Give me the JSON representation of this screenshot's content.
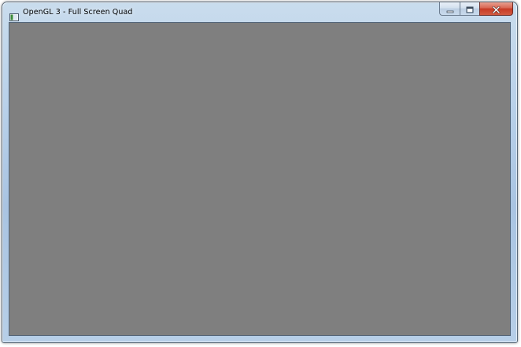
{
  "window": {
    "title": "OpenGL 3 - Full Screen Quad",
    "app_icon": "application-window-icon",
    "caption_buttons": {
      "minimize_icon": "minimize-icon",
      "maximize_icon": "maximize-icon",
      "close_icon": "close-icon"
    }
  },
  "colors": {
    "client_background": "#7f7f7f",
    "close_button": "#c73a25",
    "frame": "#b9d1ea"
  }
}
